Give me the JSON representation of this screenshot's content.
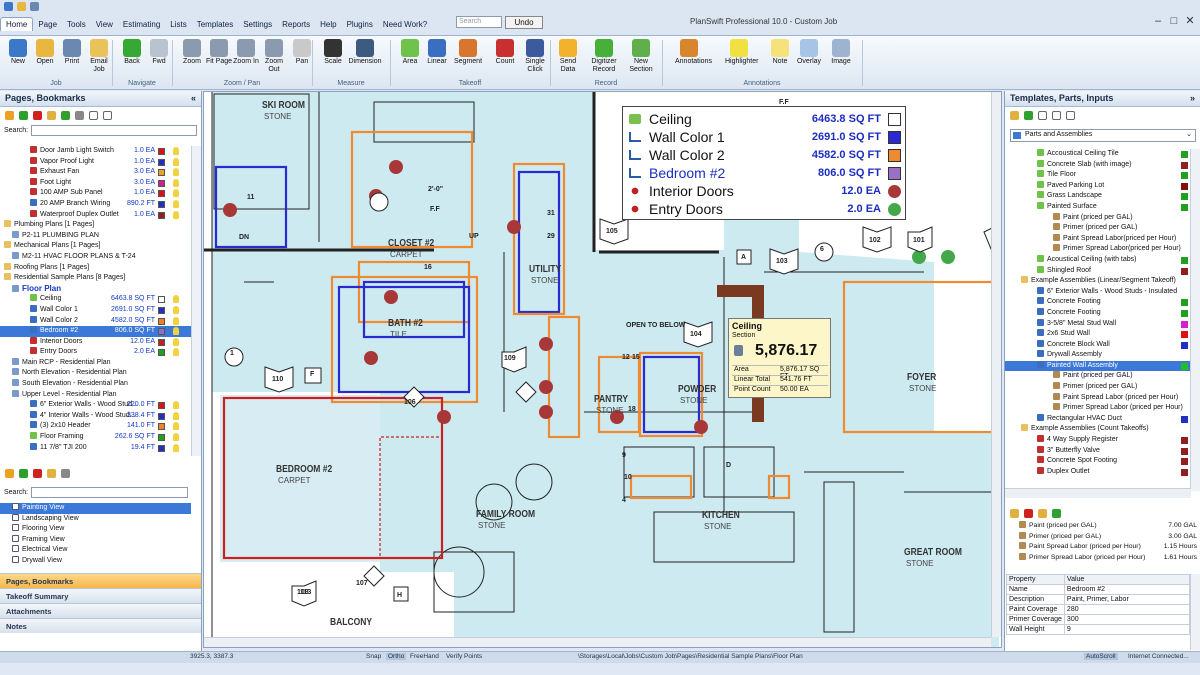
{
  "menu": {
    "tabs": [
      "Home",
      "Page",
      "Tools",
      "View",
      "Estimating",
      "Lists",
      "Templates",
      "Settings",
      "Reports",
      "Help",
      "Plugins",
      "Need Work?"
    ],
    "search_placeholder": "Search",
    "undo_label": "Undo"
  },
  "app_title": "PlanSwift Professional 10.0 - Custom Job",
  "ribbon": {
    "buttons": [
      {
        "label": "New",
        "icon": "new-icon",
        "color": "#3b78c8"
      },
      {
        "label": "Open",
        "icon": "open-folder-icon",
        "color": "#e9b640"
      },
      {
        "label": "Print",
        "icon": "print-icon",
        "color": "#6a88b0"
      },
      {
        "label": "Email Job",
        "icon": "email-icon",
        "color": "#e9c35a"
      },
      {
        "label": "Back",
        "icon": "back-arrow-icon",
        "color": "#36a834"
      },
      {
        "label": "Fwd",
        "icon": "forward-arrow-icon",
        "color": "#b9c3cf"
      },
      {
        "label": "Zoom",
        "icon": "zoom-icon",
        "color": "#8a9bb0"
      },
      {
        "label": "Fit Page",
        "icon": "fit-page-icon",
        "color": "#8a9bb0"
      },
      {
        "label": "Zoom In",
        "icon": "zoom-in-icon",
        "color": "#8a9bb0"
      },
      {
        "label": "Zoom Out",
        "icon": "zoom-out-icon",
        "color": "#8a9bb0"
      },
      {
        "label": "Pan",
        "icon": "pan-hand-icon",
        "color": "#c9c9c9"
      },
      {
        "label": "Scale",
        "icon": "scale-icon",
        "color": "#333"
      },
      {
        "label": "Dimension",
        "icon": "dimension-icon",
        "color": "#3d5a80"
      },
      {
        "label": "Area",
        "icon": "area-icon",
        "color": "#6fc24a"
      },
      {
        "label": "Linear",
        "icon": "linear-icon",
        "color": "#3a6ec0"
      },
      {
        "label": "Segment",
        "icon": "segment-icon",
        "color": "#d8762e"
      },
      {
        "label": "Count",
        "icon": "count-icon",
        "color": "#c83030"
      },
      {
        "label": "Single Click",
        "icon": "single-click-icon",
        "color": "#3d5a9e"
      },
      {
        "label": "Send Data",
        "icon": "send-data-icon",
        "color": "#f2b22d"
      },
      {
        "label": "Digitizer Record",
        "icon": "digitizer-record-icon",
        "color": "#46b03a"
      },
      {
        "label": "New Section",
        "icon": "new-section-icon",
        "color": "#5fb04a"
      },
      {
        "label": "Annotations",
        "icon": "annotations-icon",
        "color": "#d8862e"
      },
      {
        "label": "Highlighter",
        "icon": "highlighter-icon",
        "color": "#f0e040"
      },
      {
        "label": "Note",
        "icon": "note-icon",
        "color": "#f6e27a"
      },
      {
        "label": "Overlay",
        "icon": "overlay-icon",
        "color": "#a7c3e6"
      },
      {
        "label": "Image",
        "icon": "image-icon",
        "color": "#9eb3cf"
      }
    ],
    "groups": [
      "Job",
      "Navigate",
      "Zoom / Pan",
      "Measure",
      "Takeoff",
      "Record",
      "Annotations"
    ]
  },
  "left_panel": {
    "title": "Pages, Bookmarks",
    "search_label": "Search:",
    "tree": [
      {
        "label": "Door Jamb Light Switch",
        "value": "1.0 EA",
        "color": "#e01010",
        "icon": "count-icon"
      },
      {
        "label": "Vapor Proof Light",
        "value": "1.0 EA",
        "color": "#2030c0",
        "icon": "count-icon"
      },
      {
        "label": "Exhaust Fan",
        "value": "3.0 EA",
        "color": "#f0a020",
        "icon": "count-icon"
      },
      {
        "label": "Foot Light",
        "value": "3.0 EA",
        "color": "#d02090",
        "icon": "count-icon"
      },
      {
        "label": "100 AMP Sub Panel",
        "value": "1.0 EA",
        "color": "#e01010",
        "icon": "count-icon"
      },
      {
        "label": "20 AMP Branch Wiring",
        "value": "890.2 FT",
        "color": "#2030c0",
        "icon": "linear-icon"
      },
      {
        "label": "Waterproof Duplex Outlet",
        "value": "1.0 EA",
        "color": "#902020",
        "icon": "count-icon"
      },
      {
        "label": "Plumbing Plans [1 Pages]",
        "value": "",
        "color": "",
        "icon": "folder-icon"
      },
      {
        "label": "P2-11 PLUMBING PLAN",
        "value": "",
        "color": "",
        "icon": "page-icon"
      },
      {
        "label": "Mechanical Plans [1 Pages]",
        "value": "",
        "color": "",
        "icon": "folder-icon"
      },
      {
        "label": "M2-11 HVAC FLOOR PLANS & T-24",
        "value": "",
        "color": "",
        "icon": "page-icon"
      },
      {
        "label": "Roofing Plans [1 Pages]",
        "value": "",
        "color": "",
        "icon": "folder-icon"
      },
      {
        "label": "Residential Sample Plans [8 Pages]",
        "value": "",
        "color": "",
        "icon": "folder-icon"
      },
      {
        "label": "Floor Plan",
        "value": "",
        "color": "",
        "icon": "page-icon",
        "bold": true
      },
      {
        "label": "Ceiling",
        "value": "6463.8 SQ FT",
        "color": "#ffffff",
        "icon": "area-icon"
      },
      {
        "label": "Wall Color 1",
        "value": "2691.0 SQ FT",
        "color": "#2030c0",
        "icon": "linear-icon"
      },
      {
        "label": "Wall Color 2",
        "value": "4582.0 SQ FT",
        "color": "#f08020",
        "icon": "linear-icon"
      },
      {
        "label": "Bedroom #2",
        "value": "806.0 SQ FT",
        "color": "#9070c0",
        "icon": "linear-icon",
        "selected": true
      },
      {
        "label": "Interior Doors",
        "value": "12.0 EA",
        "color": "#c02020",
        "icon": "count-icon"
      },
      {
        "label": "Entry Doors",
        "value": "2.0 EA",
        "color": "#20a020",
        "icon": "count-icon"
      },
      {
        "label": "Main RCP - Residential Plan",
        "value": "",
        "color": "",
        "icon": "page-icon"
      },
      {
        "label": "North Elevation - Residential Plan",
        "value": "",
        "color": "",
        "icon": "page-icon"
      },
      {
        "label": "South Elevation - Residential Plan",
        "value": "",
        "color": "",
        "icon": "page-icon"
      },
      {
        "label": "Upper Level - Residential Plan",
        "value": "",
        "color": "",
        "icon": "page-icon"
      },
      {
        "label": "6\" Exterior Walls - Wood Stud...",
        "value": "220.0 FT",
        "color": "#e01010",
        "icon": "linear-icon"
      },
      {
        "label": "4\" Interior Walls - Wood Stud...",
        "value": "338.4 FT",
        "color": "#2030c0",
        "icon": "linear-icon"
      },
      {
        "label": "(3) 2x10 Header",
        "value": "141.0 FT",
        "color": "#f08020",
        "icon": "linear-icon"
      },
      {
        "label": "Floor Framing",
        "value": "262.6 SQ FT",
        "color": "#20a020",
        "icon": "area-icon"
      },
      {
        "label": "11 7/8\" TJI 200",
        "value": "19.4 FT",
        "color": "#2030c0",
        "icon": "linear-icon"
      }
    ],
    "views": [
      {
        "label": "Painting View",
        "selected": true
      },
      {
        "label": "Landscaping View"
      },
      {
        "label": "Flooring View"
      },
      {
        "label": "Framing View"
      },
      {
        "label": "Electrical View"
      },
      {
        "label": "Drywall View"
      }
    ],
    "sections": [
      "Pages, Bookmarks",
      "Takeoff Summary",
      "Attachments",
      "Notes"
    ]
  },
  "legend": {
    "rows": [
      {
        "name": "Ceiling",
        "value": "6463.8 SQ FT",
        "color": "#ffffff",
        "icon": "area-icon"
      },
      {
        "name": "Wall Color 1",
        "value": "2691.0 SQ FT",
        "color": "#2a2ad0",
        "icon": "linear-icon"
      },
      {
        "name": "Wall Color 2",
        "value": "4582.0 SQ FT",
        "color": "#f08a30",
        "icon": "linear-icon"
      },
      {
        "name": "Bedroom #2",
        "value": "806.0 SQ FT",
        "color": "#9a70c8",
        "icon": "linear-icon"
      },
      {
        "name": "Interior Doors",
        "value": "12.0 EA",
        "color": "#a83838",
        "icon": "count-icon"
      },
      {
        "name": "Entry Doors",
        "value": "2.0 EA",
        "color": "#44a84a",
        "icon": "count-icon"
      }
    ]
  },
  "popup": {
    "title": "Ceiling",
    "subtitle": "Section",
    "total": "5,876.17",
    "rows": [
      [
        "Area",
        "5,876.17 SQ FT"
      ],
      [
        "Linear Total",
        "541.76 FT"
      ],
      [
        "Point Count",
        "50.00 EA"
      ]
    ]
  },
  "rooms": [
    {
      "name": "SKI ROOM",
      "floor": "STONE"
    },
    {
      "name": "CLOSET #2",
      "floor": "CARPET"
    },
    {
      "name": "BATH #2",
      "floor": "TILE"
    },
    {
      "name": "UTILITY",
      "floor": "STONE"
    },
    {
      "name": "PANTRY",
      "floor": "STONE"
    },
    {
      "name": "POWDER",
      "floor": "STONE"
    },
    {
      "name": "FOYER",
      "floor": "STONE"
    },
    {
      "name": "BEDROOM #2",
      "floor": "CARPET"
    },
    {
      "name": "FAMILY ROOM",
      "floor": "STONE"
    },
    {
      "name": "KITCHEN",
      "floor": "STONE"
    },
    {
      "name": "GREAT ROOM",
      "floor": "STONE"
    },
    {
      "name": "BALCONY",
      "floor": ""
    }
  ],
  "plan_tags": [
    "105",
    "102",
    "101",
    "103",
    "104",
    "6",
    "110",
    "1",
    "109",
    "106",
    "107",
    "108",
    "113",
    "F",
    "H",
    "A",
    "D",
    "11",
    "16",
    "31",
    "29",
    "12",
    "15",
    "18",
    "9",
    "10",
    "4",
    "OPEN TO BELOW",
    "UP",
    "DN",
    "2'-0\"",
    "F.F",
    "F.F"
  ],
  "right_panel": {
    "title": "Templates, Parts, Inputs",
    "dropdown": "Parts and Assemblies",
    "tree": [
      {
        "label": "Accoustical Ceiling Tile",
        "color": "#20a020",
        "indent": 3,
        "icon": "area-icon"
      },
      {
        "label": "Concrete Slab (with image)",
        "color": "#902020",
        "indent": 3,
        "icon": "area-icon"
      },
      {
        "label": "Tile Floor",
        "color": "#20a020",
        "indent": 3,
        "icon": "area-icon"
      },
      {
        "label": "Paved Parking Lot",
        "color": "#801010",
        "indent": 3,
        "icon": "area-icon"
      },
      {
        "label": "Grass Landscape",
        "color": "#20a020",
        "indent": 3,
        "icon": "area-icon"
      },
      {
        "label": "Painted Surface",
        "color": "#20a020",
        "indent": 3,
        "icon": "area-icon"
      },
      {
        "label": "Paint (priced per GAL)",
        "color": "",
        "indent": 5,
        "icon": "paint-can-icon"
      },
      {
        "label": "Primer (priced per GAL)",
        "color": "",
        "indent": 5,
        "icon": "paint-can-icon"
      },
      {
        "label": "Paint Spread Labor(priced per Hour)",
        "color": "",
        "indent": 5,
        "icon": "brush-icon"
      },
      {
        "label": "Primer Spread Labor(priced per Hour)",
        "color": "",
        "indent": 5,
        "icon": "brush-icon"
      },
      {
        "label": "Acoustical Ceiling (with tabs)",
        "color": "#20a020",
        "indent": 3,
        "icon": "area-icon"
      },
      {
        "label": "Shingled Roof",
        "color": "#902020",
        "indent": 3,
        "icon": "area-icon"
      },
      {
        "label": "Example Assemblies (Linear/Segment Takeoff)",
        "color": "",
        "indent": 1,
        "icon": "folder-icon"
      },
      {
        "label": "6\" Exterior Walls - Wood Studs - Insulated",
        "color": "",
        "indent": 3,
        "icon": "linear-icon"
      },
      {
        "label": "Concrete Footing",
        "color": "#20a020",
        "indent": 3,
        "icon": "linear-icon"
      },
      {
        "label": "Concrete Footing",
        "color": "#20a020",
        "indent": 3,
        "icon": "linear-icon"
      },
      {
        "label": "3-5/8\" Metal Stud Wall",
        "color": "#d020d0",
        "indent": 3,
        "icon": "linear-icon"
      },
      {
        "label": "2x6 Stud Wall",
        "color": "#e01010",
        "indent": 3,
        "icon": "linear-icon"
      },
      {
        "label": "Concrete Block Wall",
        "color": "#2030c0",
        "indent": 3,
        "icon": "linear-icon"
      },
      {
        "label": "Drywall Assembly",
        "color": "",
        "indent": 3,
        "icon": "linear-icon"
      },
      {
        "label": "Painted Wall Assembly",
        "color": "#20c020",
        "indent": 3,
        "icon": "linear-icon",
        "selected": true
      },
      {
        "label": "Paint (priced per GAL)",
        "color": "",
        "indent": 5,
        "icon": "paint-can-icon"
      },
      {
        "label": "Primer (priced per GAL)",
        "color": "",
        "indent": 5,
        "icon": "paint-can-icon"
      },
      {
        "label": "Paint Spread Labor (priced per Hour)",
        "color": "",
        "indent": 5,
        "icon": "brush-icon"
      },
      {
        "label": "Primer Spread Labor (priced per Hour)",
        "color": "",
        "indent": 5,
        "icon": "brush-icon"
      },
      {
        "label": "Rectangular HVAC Duct",
        "color": "#2030c0",
        "indent": 3,
        "icon": "linear-icon"
      },
      {
        "label": "Example Assemblies (Count Takeoffs)",
        "color": "",
        "indent": 1,
        "icon": "folder-icon"
      },
      {
        "label": "4 Way Supply Register",
        "color": "#902020",
        "indent": 3,
        "icon": "count-icon"
      },
      {
        "label": "3\" Butterfly Valve",
        "color": "#902020",
        "indent": 3,
        "icon": "count-icon"
      },
      {
        "label": "Concrete Spot Footing",
        "color": "#902020",
        "indent": 3,
        "icon": "count-icon"
      },
      {
        "label": "Duplex Outlet",
        "color": "#902020",
        "indent": 3,
        "icon": "count-icon"
      }
    ],
    "results": [
      {
        "label": "Paint (priced per GAL)",
        "value": "7.00 GAL"
      },
      {
        "label": "Primer (priced per GAL)",
        "value": "3.00 GAL"
      },
      {
        "label": "Paint Spread Labor (priced per Hour)",
        "value": "1.15 Hours"
      },
      {
        "label": "Primer Spread Labor (priced per Hour)",
        "value": "1.61 Hours"
      }
    ],
    "props_header": [
      "Property",
      "Value"
    ],
    "props": [
      [
        "Name",
        "Bedroom #2"
      ],
      [
        "Description",
        "Paint, Primer, Labor"
      ],
      [
        "Paint Coverage",
        "280"
      ],
      [
        "Primer Coverage",
        "300"
      ],
      [
        "Wall Height",
        "9"
      ]
    ]
  },
  "status": {
    "coords": "3925.3, 3387.3",
    "snap": "Snap",
    "ortho": "Ortho",
    "freehand": "FreeHand",
    "verify": "Verify Points",
    "path": "\\Storages\\Local\\Jobs\\Custom Job\\Pages\\Residential Sample Plans\\Floor Plan",
    "autoscroll": "AutoScroll",
    "connection": "Internet Connected..."
  }
}
